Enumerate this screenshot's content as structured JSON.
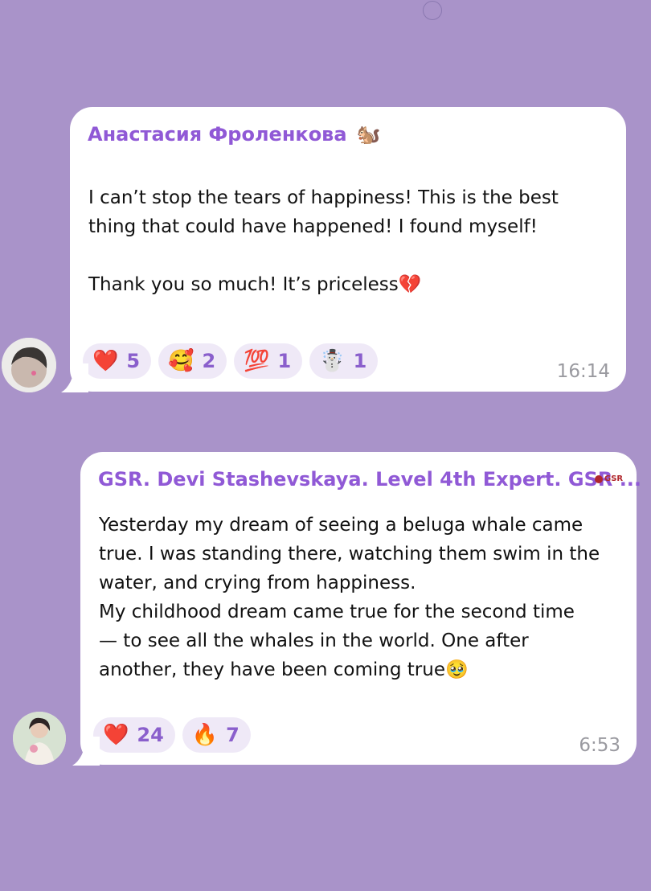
{
  "messages": [
    {
      "author": "Анастасия Фроленкова",
      "author_icon": "squirrel-icon",
      "text": "I can’t stop the tears of happiness! This is the best\nthing that could have happened! I found myself!\n\nThank you so much! It’s priceless💔",
      "reactions": [
        {
          "emoji": "❤️",
          "count": "5"
        },
        {
          "emoji": "🥰",
          "count": "2"
        },
        {
          "emoji": "💯",
          "count": "1"
        },
        {
          "emoji": "☃️",
          "count": "1"
        }
      ],
      "time": "16:14"
    },
    {
      "author": "GSR. Devi Stashevskaya. Level 4th Expert. GSR ...",
      "badge": "GSR",
      "text": "Yesterday my dream of seeing a beluga whale came\ntrue. I was standing there, watching them swim in the\nwater, and crying from happiness.\nMy childhood dream came true for the second time\n— to see all the whales in the world. One after\nanother, they have been coming true🥹",
      "reactions": [
        {
          "emoji": "❤️",
          "count": "24"
        },
        {
          "emoji": "🔥",
          "count": "7"
        }
      ],
      "time": "6:53"
    }
  ],
  "colors": {
    "background": "#a993c9",
    "author": "#9059d6",
    "reaction_chip": "#efe9f7",
    "reaction_count": "#8a5fcc",
    "time": "#9a9aa0"
  }
}
